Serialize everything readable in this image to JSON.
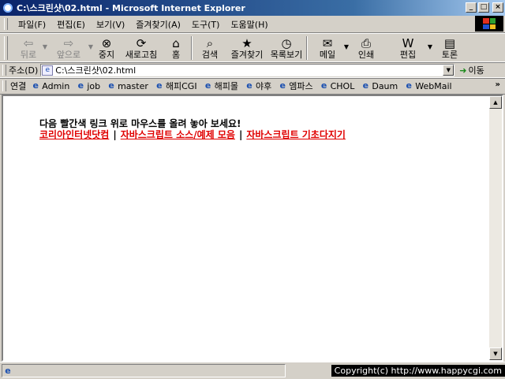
{
  "window": {
    "title": "C:\\스크린샷\\02.html - Microsoft Internet Explorer",
    "minimize_glyph": "_",
    "maximize_glyph": "□",
    "close_glyph": "×"
  },
  "menu": {
    "items": [
      "파일(F)",
      "편집(E)",
      "보기(V)",
      "즐겨찾기(A)",
      "도구(T)",
      "도움말(H)"
    ]
  },
  "toolbar": {
    "back": "뒤로",
    "forward": "앞으로",
    "stop": "중지",
    "refresh": "새로고침",
    "home": "홈",
    "search": "검색",
    "favorites": "즐겨찾기",
    "history": "목록보기",
    "mail": "메일",
    "print": "인쇄",
    "edit": "편집",
    "discuss": "토론"
  },
  "address": {
    "label": "주소(D)",
    "value": "C:\\스크린샷\\02.html",
    "go_label": "이동"
  },
  "links": {
    "label": "연결",
    "items": [
      "Admin",
      "job",
      "master",
      "해피CGI",
      "해피몰",
      "야후",
      "엠파스",
      "CHOL",
      "Daum",
      "WebMail"
    ],
    "more": "»"
  },
  "page": {
    "instruction": "다음 빨간색 링크 위로 마우스를 올려 놓아 보세요!",
    "link_1": "코리아인터넷닷컴",
    "link_2": "자바스크립트 소스/예제 모음",
    "link_3": "자바스크립트 기초다지기",
    "separator": "|"
  },
  "status": {
    "copyright": "Copyright(c) http://www.happycgi.com"
  },
  "colors": {
    "link": "#e00000",
    "title_bar": "#0a246a"
  }
}
